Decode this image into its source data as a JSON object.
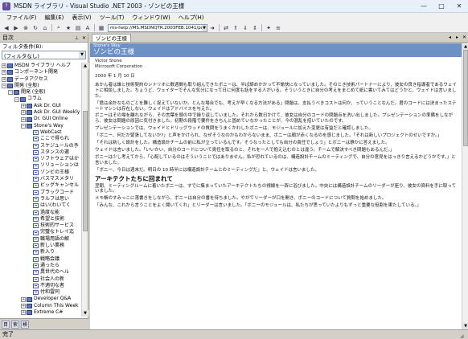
{
  "window": {
    "title": "MSDN ライブラリ - Visual Studio .NET 2003 - ゾンビの王様",
    "minimize": "—",
    "maximize": "□",
    "close": "✕"
  },
  "menu": [
    "ファイル(F)",
    "編集(E)",
    "表示(V)",
    "ツール(T)",
    "ウィンドウ(W)",
    "ヘルプ(H)"
  ],
  "toolbar": {
    "url": "ms-help://MS.MSDNQTR.2003FEB.1041/pdnsto",
    "icons": [
      "back-icon",
      "forward-icon",
      "stop-icon",
      "refresh-icon",
      "home-icon",
      "search-icon",
      "favorites-icon",
      "print-icon",
      "sync-icon",
      "prev-topic-icon",
      "next-topic-icon",
      "font-icon"
    ]
  },
  "left_pane": {
    "title": "目次",
    "filter_label": "フィルタ条件(B):",
    "filter_value": "(フィルタなし)",
    "tree": [
      {
        "indent": 0,
        "toggle": "+",
        "icon": "book",
        "label": "MSDN ライブラリ ヘルプ"
      },
      {
        "indent": 0,
        "toggle": "+",
        "icon": "book",
        "label": "コンポーネント開発"
      },
      {
        "indent": 0,
        "toggle": "+",
        "icon": "book",
        "label": "データアクセス"
      },
      {
        "indent": 0,
        "toggle": "−",
        "icon": "book",
        "label": "開発 (全般)"
      },
      {
        "indent": 1,
        "toggle": "−",
        "icon": "book",
        "label": "開発 (全般)"
      },
      {
        "indent": 2,
        "toggle": "−",
        "icon": "book",
        "label": "コラム"
      },
      {
        "indent": 3,
        "toggle": "+",
        "icon": "book",
        "label": "Ask Dr. GUI"
      },
      {
        "indent": 3,
        "toggle": "+",
        "icon": "book",
        "label": "Ask Dr. GUI Weekly"
      },
      {
        "indent": 3,
        "toggle": "+",
        "icon": "book",
        "label": "Dr. GUI Online"
      },
      {
        "indent": 3,
        "toggle": "−",
        "icon": "book",
        "label": "Stone's Way"
      },
      {
        "indent": 4,
        "toggle": "",
        "icon": "page",
        "label": "WebCast"
      },
      {
        "indent": 4,
        "toggle": "",
        "icon": "page",
        "label": "ここで得られ"
      },
      {
        "indent": 4,
        "toggle": "",
        "icon": "page",
        "label": "スケジュールの予"
      },
      {
        "indent": 4,
        "toggle": "",
        "icon": "page",
        "label": "スタンスの選"
      },
      {
        "indent": 4,
        "toggle": "",
        "icon": "page",
        "label": "ソフトウェアはか"
      },
      {
        "indent": 4,
        "toggle": "",
        "icon": "page",
        "label": "ソリューションは"
      },
      {
        "indent": 4,
        "toggle": "",
        "icon": "page",
        "label": "ゾンビの王様"
      },
      {
        "indent": 4,
        "toggle": "",
        "icon": "page",
        "label": "バスマスメタリ"
      },
      {
        "indent": 4,
        "toggle": "",
        "icon": "page",
        "label": "ビッグキャンセル"
      },
      {
        "indent": 4,
        "toggle": "",
        "icon": "page",
        "label": "ブラックコード"
      },
      {
        "indent": 4,
        "toggle": "",
        "icon": "page",
        "label": "ラルフは思い"
      },
      {
        "indent": 4,
        "toggle": "",
        "icon": "page",
        "label": "はい(わいてく"
      },
      {
        "indent": 4,
        "toggle": "",
        "icon": "page",
        "label": "過度な能"
      },
      {
        "indent": 4,
        "toggle": "",
        "icon": "page",
        "label": "希望と技術"
      },
      {
        "indent": 4,
        "toggle": "",
        "icon": "page",
        "label": "技術的サービス"
      },
      {
        "indent": 4,
        "toggle": "",
        "icon": "page",
        "label": "完璧なトレイ迄"
      },
      {
        "indent": 4,
        "toggle": "",
        "icon": "page",
        "label": "職場用語の解"
      },
      {
        "indent": 4,
        "toggle": "",
        "icon": "page",
        "label": "新しい業務"
      },
      {
        "indent": 4,
        "toggle": "",
        "icon": "page",
        "label": "新入り"
      },
      {
        "indent": 4,
        "toggle": "",
        "icon": "page",
        "label": "戦略会議"
      },
      {
        "indent": 4,
        "toggle": "",
        "icon": "page",
        "label": "通ったら"
      },
      {
        "indent": 4,
        "toggle": "",
        "icon": "page",
        "label": "異世代のヘル"
      },
      {
        "indent": 4,
        "toggle": "",
        "icon": "page",
        "label": "社会人の新"
      },
      {
        "indent": 4,
        "toggle": "",
        "icon": "page",
        "label": "不適切な者"
      },
      {
        "indent": 4,
        "toggle": "",
        "icon": "page",
        "label": "付和雷同"
      },
      {
        "indent": 3,
        "toggle": "+",
        "icon": "book",
        "label": "Developer Q&A"
      },
      {
        "indent": 3,
        "toggle": "+",
        "icon": "book",
        "label": "Column This Week"
      },
      {
        "indent": 3,
        "toggle": "+",
        "icon": "book",
        "label": "Extreme C#"
      }
    ],
    "bottom_tabs": [
      "目次タブ",
      "索引タブ",
      "検索タブ"
    ]
  },
  "doc": {
    "tab_label": "ゾンビの王様",
    "series": "Stone's Way",
    "title": "ゾンビの王様",
    "author": "Victor Stone",
    "company": "Microsoft Corporation",
    "date": "2000 年 1 月 10 日",
    "paragraphs": [
      "あかん者は誰と技術契約のシナリオに数週間も取り組んできたボニーは、半ば諦めかかって不愉快になっていました。そのとき技術パートナーにより、彼女の良き指導者であるウェイトに相談しました。ちょうど、ウェイターでそんな気分になって日に何度も話をする人がいる。そういうときに自分の考えをまとめて紙に書いてみてはどうかと、ウェイドは言いました。",
      "「君は余計なものごとを難しく捉えていないか。とんな場合でも、考えが早くなる方法がある」問題は、支払うべきコストは何か、っていうことなんだ。君のコードには決まったステートマシンは存在しない。ウェイドはアドバイスを与えた。",
      "ボニーはその場を離れながら、その言葉を頭の中で繰り返していました。それから数日かけて、彼女は自分のコードの問題点を洗い出しました。プレゼンテーションの準備をしながら、彼女は問題の原因に気付きました。初期の段階で要件をきちんと固めていなかったことが、今の混乱を招いていたのです。",
      "プレゼンテーションでは、ウェイドとドリッグウッドの質問をうまくかわしたボニーは、モジュールに加えた変更は有益だと確認しました。",
      "「ボニー、何だか緊張してないか?」と声をかけられ、なぜそうなのかもわからないまま、ボニーは顔が赤くなるのを感じました。「それは新しいプロジェクトのせいですか。」",
      "「それは新しく設計をした。構造設計チームの前に私が立っているんです。そうなったとしても自分の責任でしょう」とボニーは静かに答えました。",
      "ウェイドは言いました。「いいかい、自分のコードについて責任を取るのと、それを一人で抱え込むのとは違う。チームで解決すべき問題もあるんだ。」",
      "ボニーは少し考えてから、「心配しているのはそういうことではありません。私が恐れているのは、構造設計チームのミーティングで、自分の意見をはっきり言えるかどうかです。」と言いました。",
      "「ボニー、今日は週末だ。明日の 10 時半には構造設計チームとのミーティングだ」と、ウェイドは言いました。"
    ],
    "section_heading": "アーキテクトたちに回まれて",
    "section_paragraphs": [
      "翌朝、ミーティングルームに着いたボニーは、すでに集まっていたアーキテクトたちの視線を一斉に浴びました。中央には構造設計チームのリーダーが座り、彼女の資料を手に取っていました。",
      "メモ帳のすみっこに落書きをしながら、ボニーは自分の番を待ちました。やがてリーダーが口を開き、ボニーのコードについて質問を始めました。",
      "「みんな、これから言うことをよく聞いてくれ」とリーダーは言いました。「ボニーのモジュールは、私たちが思っていたよりもずっと重要な役割を果たしている。」"
    ]
  },
  "status": "完了"
}
